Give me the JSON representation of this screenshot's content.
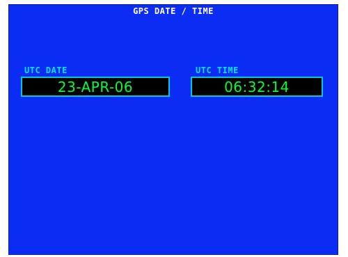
{
  "page": {
    "title": "GPS DATE / TIME"
  },
  "fields": {
    "utc_date": {
      "label": "UTC DATE",
      "value": "23-APR-06"
    },
    "utc_time": {
      "label": "UTC TIME",
      "value": "06:32:14"
    }
  },
  "colors": {
    "background": "#0a2cf3",
    "label": "#00e5ff",
    "value": "#00ff33",
    "field_border": "#00c8d8",
    "field_background": "#000000",
    "title": "#ffffff"
  }
}
